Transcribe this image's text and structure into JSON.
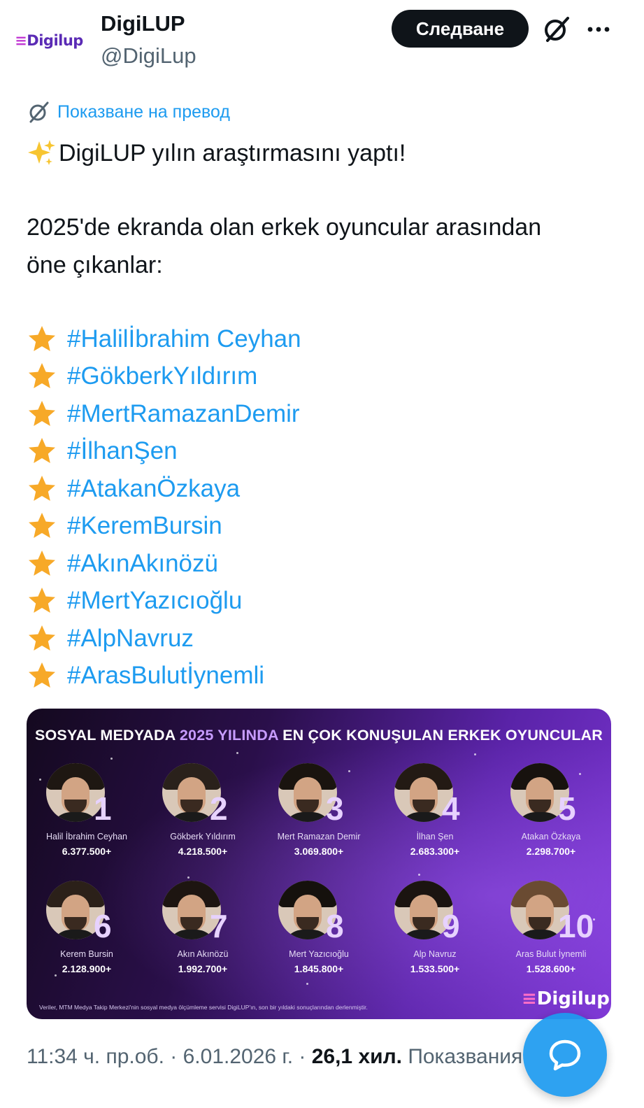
{
  "header": {
    "avatar_logo_text": "Digilup",
    "display_name": "DigiLUP",
    "handle": "@DigiLup",
    "follow_label": "Следване",
    "icons": {
      "grok": "slashed-circle-icon",
      "more": "more-horizontal-icon"
    }
  },
  "translate": {
    "label": "Показване на превод",
    "icon": "translate-icon"
  },
  "tweet": {
    "line1": "DigiLUP yılın araştırmasını yaptı!",
    "line2": "2025'de ekranda olan erkek oyuncular arasından",
    "line3": "öne çıkanlar:",
    "hashtags": [
      "#Halilİbrahim Ceyhan",
      "#GökberkYıldırım",
      "#MertRamazanDemir",
      "#İlhanŞen",
      "#AtakanÖzkaya",
      "#KeremBursin",
      "#AkınAkınözü",
      "#MertYazıcıoğlu",
      "#AlpNavruz",
      "#ArasBulutİynemli"
    ]
  },
  "media": {
    "title_part1": "SOSYAL MEDYADA",
    "title_year": "2025 YILINDA",
    "title_part2": "EN ÇOK KONUŞULAN ERKEK OYUNCULAR",
    "footnote": "Veriler, MTM Medya Takip Merkezi'nin sosyal medya ölçümleme servisi DigiLUP'ın, son bir yıldaki sonuçlarından derlenmiştir.",
    "logo": "Digilup",
    "actors": [
      {
        "rank": "1",
        "name": "Halil İbrahim Ceyhan",
        "value": "6.377.500+"
      },
      {
        "rank": "2",
        "name": "Gökberk Yıldırım",
        "value": "4.218.500+"
      },
      {
        "rank": "3",
        "name": "Mert Ramazan Demir",
        "value": "3.069.800+"
      },
      {
        "rank": "4",
        "name": "İlhan Şen",
        "value": "2.683.300+"
      },
      {
        "rank": "5",
        "name": "Atakan Özkaya",
        "value": "2.298.700+"
      },
      {
        "rank": "6",
        "name": "Kerem Bursin",
        "value": "2.128.900+"
      },
      {
        "rank": "7",
        "name": "Akın Akınözü",
        "value": "1.992.700+"
      },
      {
        "rank": "8",
        "name": "Mert Yazıcıoğlu",
        "value": "1.845.800+"
      },
      {
        "rank": "9",
        "name": "Alp Navruz",
        "value": "1.533.500+"
      },
      {
        "rank": "10",
        "name": "Aras Bulut İynemli",
        "value": "1.528.600+"
      }
    ]
  },
  "meta": {
    "time": "11:34 ч. пр.об.",
    "date": "6.01.2026 г.",
    "views_count": "26,1 хил.",
    "views_label": "Показвания"
  },
  "fab": {
    "icon": "reply-bubble-icon"
  },
  "colors": {
    "link": "#1d9bf0",
    "text": "#0f1419",
    "muted": "#536471",
    "button": "#0f1419"
  }
}
